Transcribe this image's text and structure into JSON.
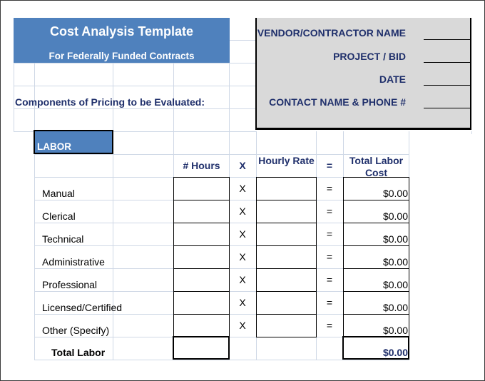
{
  "header": {
    "title": "Cost Analysis Template",
    "subtitle": "For Federally Funded Contracts"
  },
  "components_label": "Components of Pricing to be Evaluated:",
  "vendor_box": {
    "fields": [
      {
        "label": "VENDOR/CONTRACTOR NAME",
        "value": ""
      },
      {
        "label": "PROJECT / BID",
        "value": ""
      },
      {
        "label": "DATE",
        "value": ""
      },
      {
        "label": "CONTACT NAME & PHONE #",
        "value": ""
      }
    ]
  },
  "labor": {
    "section_label": "LABOR",
    "columns": {
      "hours": "# Hours",
      "times": "X",
      "rate": "Hourly Rate",
      "equals": "=",
      "total": "Total Labor Cost"
    },
    "rows": [
      {
        "label": "Manual",
        "hours": "",
        "op1": "X",
        "rate": "",
        "op2": "=",
        "total": "$0.00"
      },
      {
        "label": "Clerical",
        "hours": "",
        "op1": "X",
        "rate": "",
        "op2": "=",
        "total": "$0.00"
      },
      {
        "label": "Technical",
        "hours": "",
        "op1": "X",
        "rate": "",
        "op2": "=",
        "total": "$0.00"
      },
      {
        "label": "Administrative",
        "hours": "",
        "op1": "X",
        "rate": "",
        "op2": "=",
        "total": "$0.00"
      },
      {
        "label": "Professional",
        "hours": "",
        "op1": "X",
        "rate": "",
        "op2": "=",
        "total": "$0.00"
      },
      {
        "label": "Licensed/Certified",
        "hours": "",
        "op1": "X",
        "rate": "",
        "op2": "=",
        "total": "$0.00"
      },
      {
        "label": "Other (Specify)",
        "hours": "",
        "op1": "X",
        "rate": "",
        "op2": "=",
        "total": "$0.00"
      }
    ],
    "total_row": {
      "label": "Total Labor",
      "hours": "",
      "total": "$0.00"
    }
  }
}
